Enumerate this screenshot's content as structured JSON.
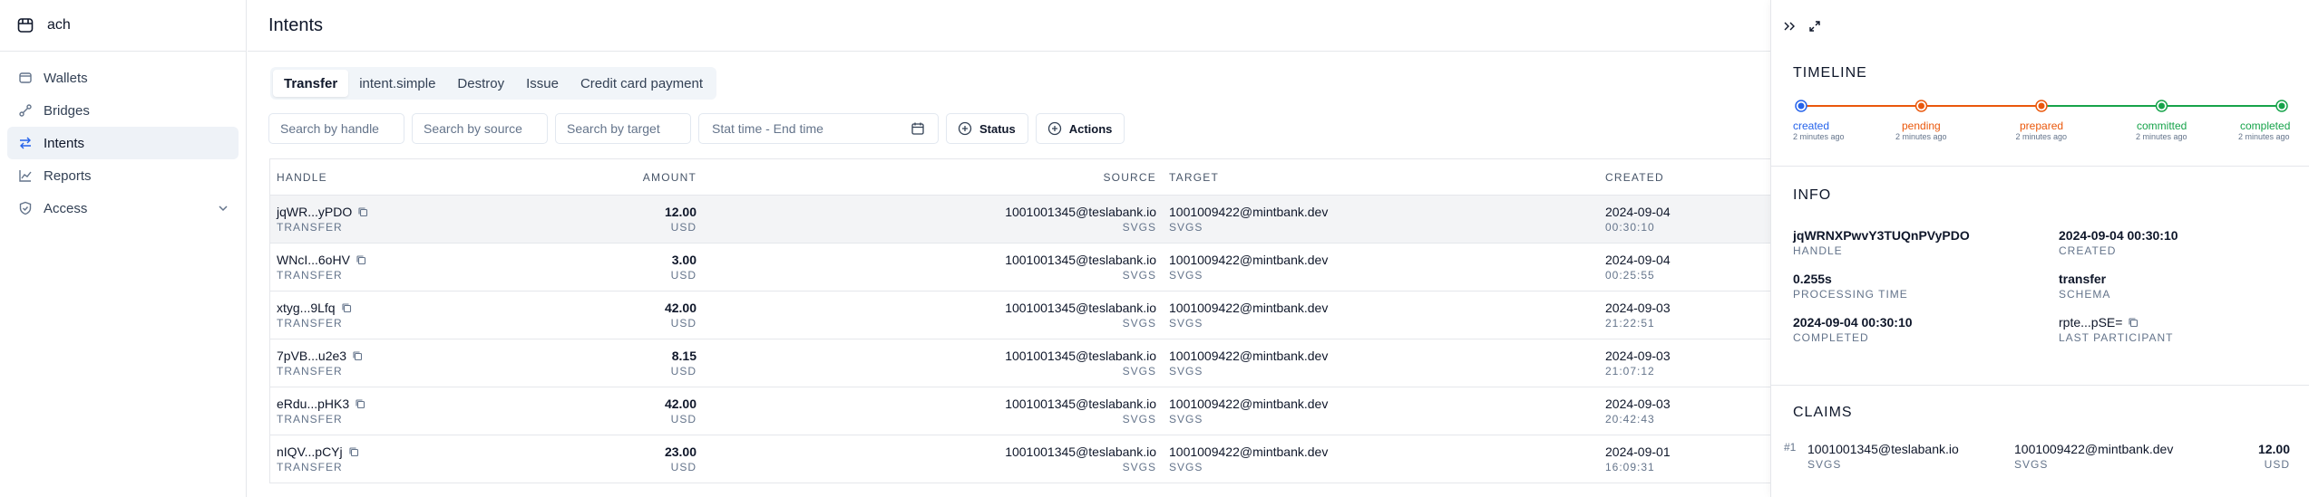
{
  "app": {
    "name": "ach"
  },
  "sidebar": {
    "items": [
      {
        "label": "Wallets",
        "icon": "wallet-icon"
      },
      {
        "label": "Bridges",
        "icon": "bridge-icon"
      },
      {
        "label": "Intents",
        "icon": "arrows-icon",
        "active": true
      },
      {
        "label": "Reports",
        "icon": "chart-icon"
      },
      {
        "label": "Access",
        "icon": "shield-icon"
      }
    ]
  },
  "header": {
    "title": "Intents"
  },
  "tabs": [
    {
      "label": "Transfer",
      "active": true
    },
    {
      "label": "intent.simple"
    },
    {
      "label": "Destroy"
    },
    {
      "label": "Issue"
    },
    {
      "label": "Credit card payment"
    }
  ],
  "filters": {
    "handle_placeholder": "Search by handle",
    "source_placeholder": "Search by source",
    "target_placeholder": "Search by target",
    "date_placeholder": "Stat time - End time",
    "status_label": "Status",
    "actions_label": "Actions"
  },
  "table": {
    "headers": {
      "handle": "HANDLE",
      "amount": "AMOUNT",
      "source": "SOURCE",
      "target": "TARGET",
      "created": "CREATED"
    },
    "rows": [
      {
        "handle": "jqWR...yPDO",
        "type": "TRANSFER",
        "amount": "12.00",
        "currency": "USD",
        "source": "1001001345@teslabank.io",
        "source_sub": "SVGS",
        "target": "1001009422@mintbank.dev",
        "target_sub": "SVGS",
        "date": "2024-09-04",
        "time": "00:30:10",
        "selected": true
      },
      {
        "handle": "WNcI...6oHV",
        "type": "TRANSFER",
        "amount": "3.00",
        "currency": "USD",
        "source": "1001001345@teslabank.io",
        "source_sub": "SVGS",
        "target": "1001009422@mintbank.dev",
        "target_sub": "SVGS",
        "date": "2024-09-04",
        "time": "00:25:55"
      },
      {
        "handle": "xtyg...9Lfq",
        "type": "TRANSFER",
        "amount": "42.00",
        "currency": "USD",
        "source": "1001001345@teslabank.io",
        "source_sub": "SVGS",
        "target": "1001009422@mintbank.dev",
        "target_sub": "SVGS",
        "date": "2024-09-03",
        "time": "21:22:51"
      },
      {
        "handle": "7pVB...u2e3",
        "type": "TRANSFER",
        "amount": "8.15",
        "currency": "USD",
        "source": "1001001345@teslabank.io",
        "source_sub": "SVGS",
        "target": "1001009422@mintbank.dev",
        "target_sub": "SVGS",
        "date": "2024-09-03",
        "time": "21:07:12"
      },
      {
        "handle": "eRdu...pHK3",
        "type": "TRANSFER",
        "amount": "42.00",
        "currency": "USD",
        "source": "1001001345@teslabank.io",
        "source_sub": "SVGS",
        "target": "1001009422@mintbank.dev",
        "target_sub": "SVGS",
        "date": "2024-09-03",
        "time": "20:42:43"
      },
      {
        "handle": "nIQV...pCYj",
        "type": "TRANSFER",
        "amount": "23.00",
        "currency": "USD",
        "source": "1001001345@teslabank.io",
        "source_sub": "SVGS",
        "target": "1001009422@mintbank.dev",
        "target_sub": "SVGS",
        "date": "2024-09-01",
        "time": "16:09:31"
      }
    ]
  },
  "panel": {
    "timeline_title": "TIMELINE",
    "timeline": [
      {
        "label": "created",
        "time": "2 minutes ago",
        "color": "#2563eb"
      },
      {
        "label": "pending",
        "time": "2 minutes ago",
        "color": "#ea580c"
      },
      {
        "label": "prepared",
        "time": "2 minutes ago",
        "color": "#ea580c"
      },
      {
        "label": "committed",
        "time": "2 minutes ago",
        "color": "#16a34a"
      },
      {
        "label": "completed",
        "time": "2 minutes ago",
        "color": "#16a34a"
      }
    ],
    "info_title": "INFO",
    "info": {
      "handle": "jqWRNXPwvY3TUQnPVyPDO",
      "handle_label": "HANDLE",
      "created": "2024-09-04 00:30:10",
      "created_label": "CREATED",
      "processing": "0.255s",
      "processing_label": "PROCESSING TIME",
      "schema": "transfer",
      "schema_label": "SCHEMA",
      "completed": "2024-09-04 00:30:10",
      "completed_label": "COMPLETED",
      "participant": "rpte...pSE=",
      "participant_label": "LAST PARTICIPANT"
    },
    "claims_title": "CLAIMS",
    "claims": [
      {
        "index": "#1",
        "source": "1001001345@teslabank.io",
        "source_sub": "SVGS",
        "target": "1001009422@mintbank.dev",
        "target_sub": "SVGS",
        "amount": "12.00",
        "currency": "USD"
      }
    ]
  }
}
